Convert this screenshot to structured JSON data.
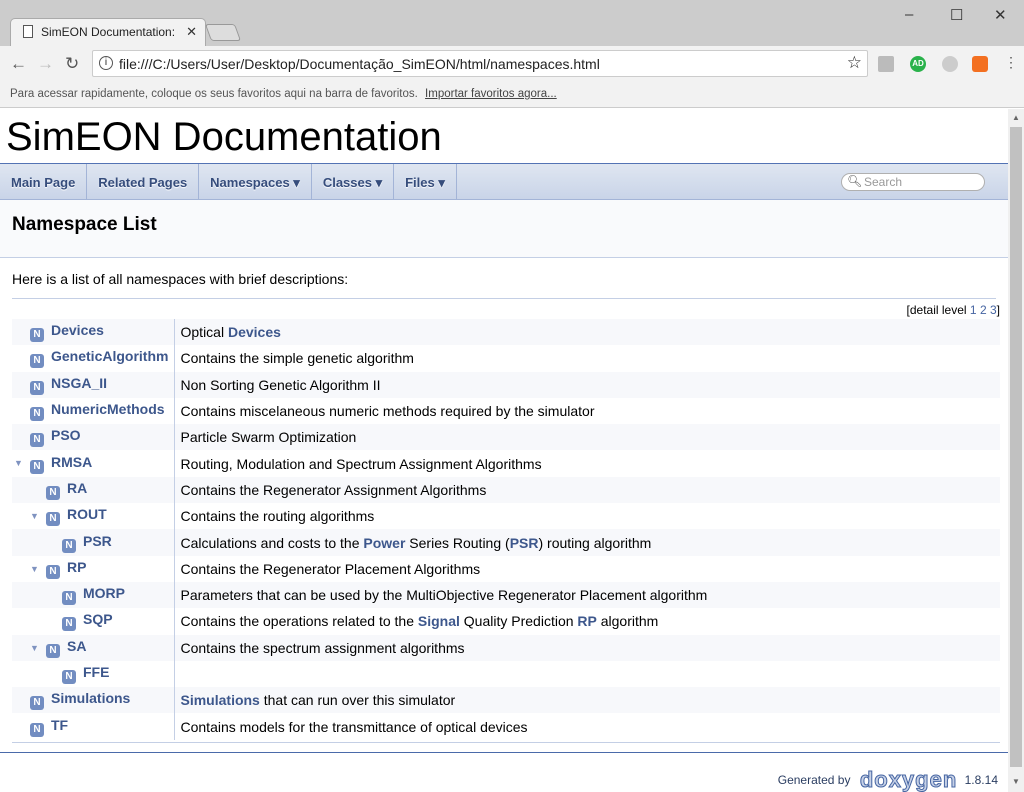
{
  "browser": {
    "tab_title": "SimEON Documentation:",
    "url": "file:///C:/Users/User/Desktop/Documentação_SimEON/html/namespaces.html",
    "bookmarks_text": "Para acessar rapidamente, coloque os seus favoritos aqui na barra de favoritos.",
    "bookmarks_link": "Importar favoritos agora...",
    "ext_ad": "AD"
  },
  "project_name": "SimEON Documentation",
  "navbar": {
    "items": [
      "Main Page",
      "Related Pages",
      "Namespaces ▾",
      "Classes ▾",
      "Files ▾"
    ],
    "search_placeholder": "Search"
  },
  "page_title": "Namespace List",
  "intro": "Here is a list of all namespaces with brief descriptions:",
  "detail_level": {
    "label": "[detail level",
    "levels": [
      "1",
      "2",
      "3"
    ],
    "close": "]"
  },
  "namespaces": [
    {
      "name": "Devices",
      "level": 0,
      "desc": [
        "Optical ",
        {
          "link": "Devices"
        }
      ]
    },
    {
      "name": "GeneticAlgorithm",
      "level": 0,
      "desc": [
        "Contains the simple genetic algorithm"
      ]
    },
    {
      "name": "NSGA_II",
      "level": 0,
      "desc": [
        "Non Sorting Genetic Algorithm II"
      ]
    },
    {
      "name": "NumericMethods",
      "level": 0,
      "desc": [
        "Contains miscelaneous numeric methods required by the simulator"
      ]
    },
    {
      "name": "PSO",
      "level": 0,
      "desc": [
        "Particle Swarm Optimization"
      ]
    },
    {
      "name": "RMSA",
      "level": 0,
      "expanded": true,
      "desc": [
        "Routing, Modulation and Spectrum Assignment Algorithms"
      ]
    },
    {
      "name": "RA",
      "level": 1,
      "desc": [
        "Contains the Regenerator Assignment Algorithms"
      ]
    },
    {
      "name": "ROUT",
      "level": 1,
      "expanded": true,
      "desc": [
        "Contains the routing algorithms"
      ]
    },
    {
      "name": "PSR",
      "level": 2,
      "desc": [
        "Calculations and costs to the ",
        {
          "link": "Power"
        },
        " Series Routing (",
        {
          "link": "PSR"
        },
        ") routing algorithm"
      ]
    },
    {
      "name": "RP",
      "level": 1,
      "expanded": true,
      "desc": [
        "Contains the Regenerator Placement Algorithms"
      ]
    },
    {
      "name": "MORP",
      "level": 2,
      "desc": [
        "Parameters that can be used by the MultiObjective Regenerator Placement algorithm"
      ]
    },
    {
      "name": "SQP",
      "level": 2,
      "desc": [
        "Contains the operations related to the ",
        {
          "link": "Signal"
        },
        " Quality Prediction ",
        {
          "link": "RP"
        },
        " algorithm"
      ]
    },
    {
      "name": "SA",
      "level": 1,
      "expanded": true,
      "desc": [
        "Contains the spectrum assignment algorithms"
      ]
    },
    {
      "name": "FFE",
      "level": 2,
      "desc": []
    },
    {
      "name": "Simulations",
      "level": 0,
      "desc": [
        {
          "link": "Simulations"
        },
        " that can run over this simulator"
      ]
    },
    {
      "name": "TF",
      "level": 0,
      "desc": [
        "Contains models for the transmittance of optical devices"
      ]
    }
  ],
  "namespace_icon": "N",
  "footer": {
    "generated_by": "Generated by",
    "logo": "doxygen",
    "version": "1.8.14"
  }
}
